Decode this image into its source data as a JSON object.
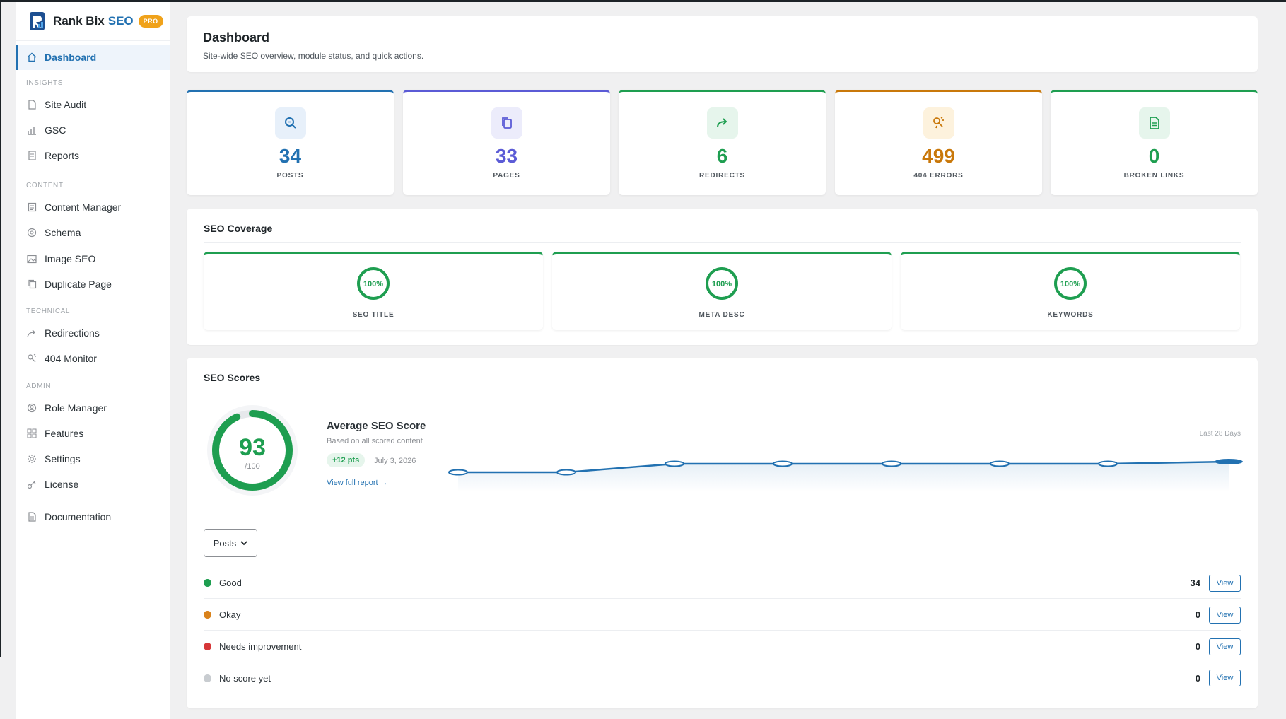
{
  "brand": {
    "name": "Rank Bix",
    "accent": "SEO",
    "badge": "PRO"
  },
  "sidebar": {
    "dashboard": "Dashboard",
    "sections": {
      "insights": "INSIGHTS",
      "content": "CONTENT",
      "technical": "TECHNICAL",
      "admin": "ADMIN"
    },
    "items": {
      "site_audit": "Site Audit",
      "gsc": "GSC",
      "reports": "Reports",
      "content_manager": "Content Manager",
      "schema": "Schema",
      "image_seo": "Image SEO",
      "duplicate_page": "Duplicate Page",
      "redirections": "Redirections",
      "monitor_404": "404 Monitor",
      "role_manager": "Role Manager",
      "features": "Features",
      "settings": "Settings",
      "license": "License",
      "documentation": "Documentation"
    }
  },
  "header": {
    "title": "Dashboard",
    "subtitle": "Site-wide SEO overview, module status, and quick actions."
  },
  "stats": [
    {
      "value": "34",
      "label": "POSTS",
      "color": "#2271b1",
      "bg": "#e7f0fa",
      "icon": "search-doc-icon"
    },
    {
      "value": "33",
      "label": "PAGES",
      "color": "#5b5bd6",
      "bg": "#ececfb",
      "icon": "copy-icon"
    },
    {
      "value": "6",
      "label": "REDIRECTS",
      "color": "#1e9e50",
      "bg": "#e6f5ec",
      "icon": "redirect-arrow-icon"
    },
    {
      "value": "499",
      "label": "404 ERRORS",
      "color": "#c9780a",
      "bg": "#fdf2dd",
      "icon": "broken-link-icon"
    },
    {
      "value": "0",
      "label": "BROKEN LINKS",
      "color": "#1e9e50",
      "bg": "#e6f5ec",
      "icon": "document-icon"
    }
  ],
  "coverage": {
    "title": "SEO Coverage",
    "items": [
      {
        "percent": "100%",
        "label": "SEO TITLE"
      },
      {
        "percent": "100%",
        "label": "META DESC"
      },
      {
        "percent": "100%",
        "label": "KEYWORDS"
      }
    ]
  },
  "scores": {
    "title": "SEO Scores",
    "gauge_value": "93",
    "gauge_max": "/100",
    "gauge_fraction": 0.93,
    "avg_title": "Average SEO Score",
    "avg_sub": "Based on all scored content",
    "pts_badge": "+12 pts",
    "date": "July 3, 2026",
    "full_report": "View full report →",
    "last_days": "Last 28 Days",
    "select_value": "Posts",
    "rows": [
      {
        "label": "Good",
        "count": "34",
        "color": "#1e9e50",
        "action": "View"
      },
      {
        "label": "Okay",
        "count": "0",
        "color": "#d9821b",
        "action": "View"
      },
      {
        "label": "Needs improvement",
        "count": "0",
        "color": "#d63638",
        "action": "View"
      },
      {
        "label": "No score yet",
        "count": "0",
        "color": "#c8ccd0",
        "action": "View"
      }
    ]
  },
  "colors": {
    "primary": "#2271b1",
    "success": "#1e9e50",
    "warning": "#c9780a",
    "danger": "#d63638"
  }
}
